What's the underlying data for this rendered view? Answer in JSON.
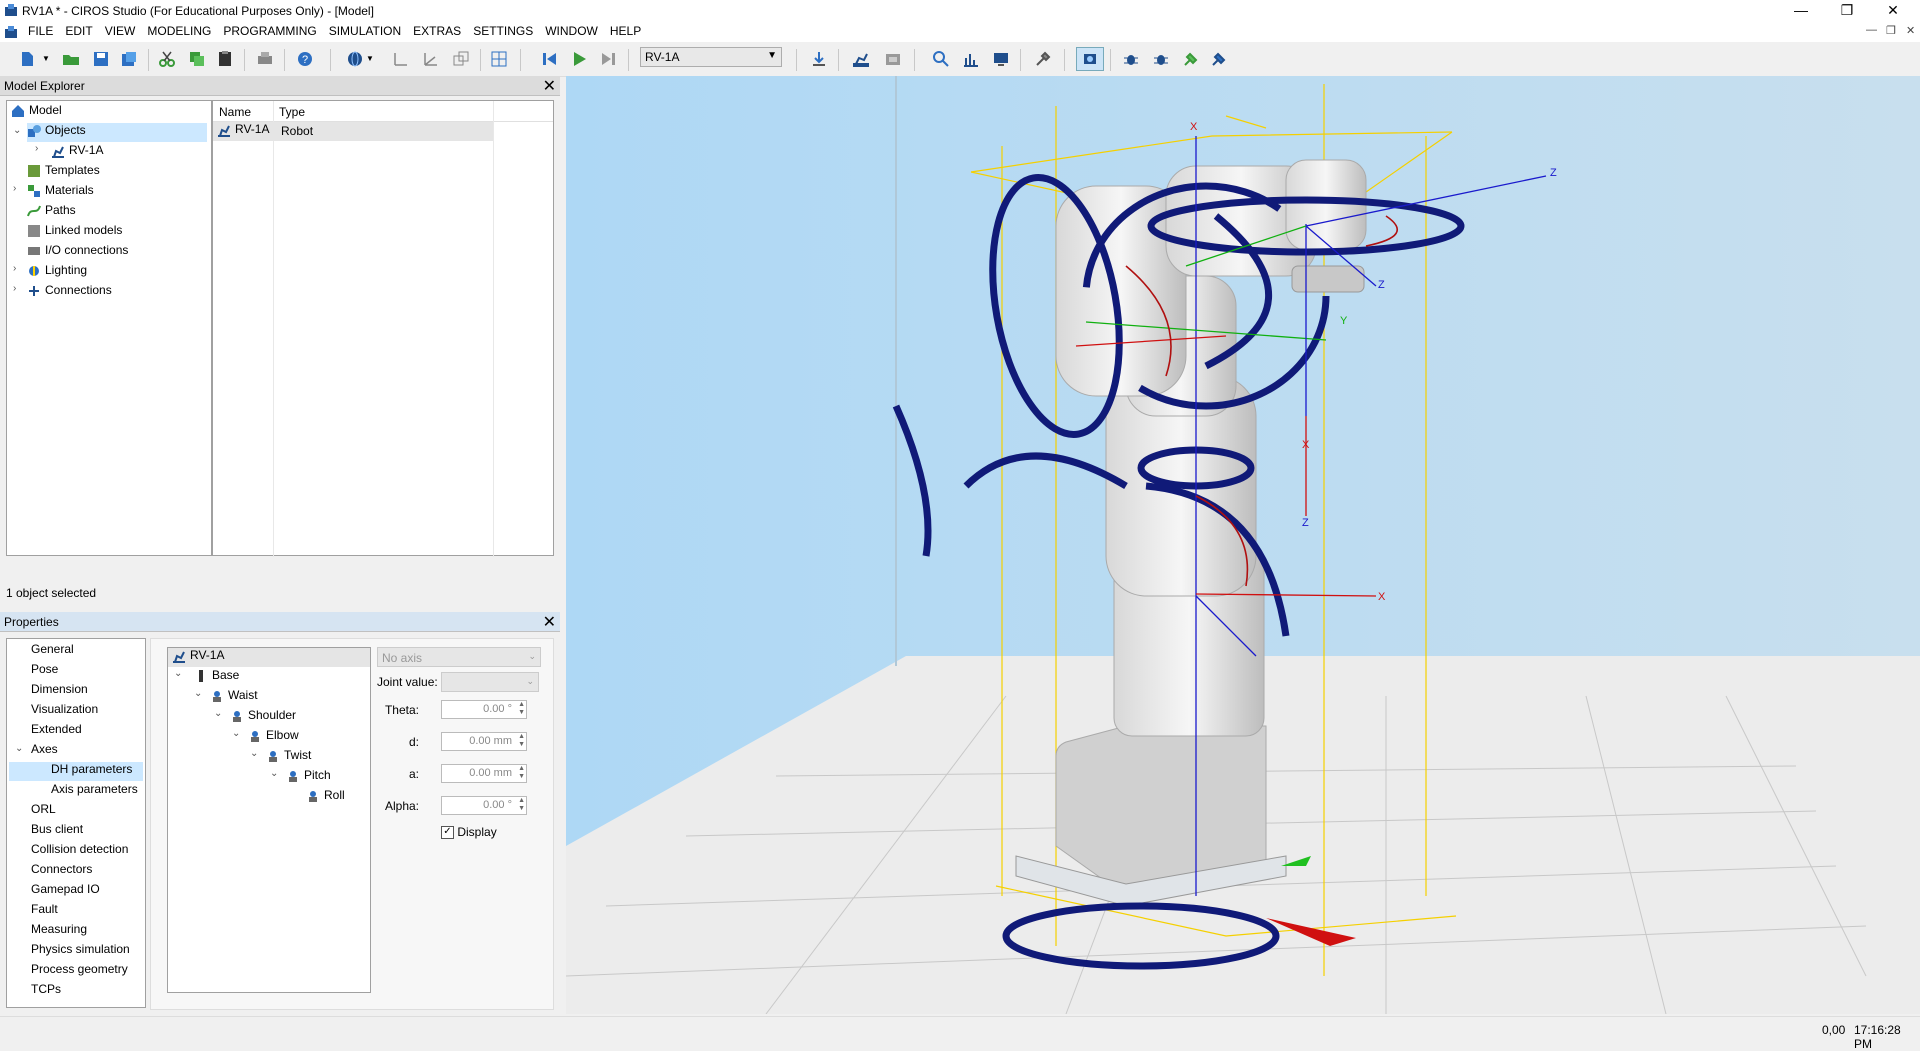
{
  "window": {
    "title": "RV1A * - CIROS Studio (For Educational Purposes Only) - [Model]",
    "minimize": "—",
    "restore": "❐",
    "close": "✕"
  },
  "menu": [
    "FILE",
    "EDIT",
    "VIEW",
    "MODELING",
    "PROGRAMMING",
    "SIMULATION",
    "EXTRAS",
    "SETTINGS",
    "WINDOW",
    "HELP"
  ],
  "toolbar": {
    "robot_select": "RV-1A"
  },
  "model_explorer": {
    "title": "Model Explorer",
    "tree": [
      {
        "label": "Model",
        "icon": "model-icon"
      },
      {
        "label": "Objects",
        "icon": "objects-icon"
      },
      {
        "label": "RV-1A",
        "icon": "robot-icon"
      },
      {
        "label": "Templates",
        "icon": "templates-icon"
      },
      {
        "label": "Materials",
        "icon": "materials-icon"
      },
      {
        "label": "Paths",
        "icon": "paths-icon"
      },
      {
        "label": "Linked models",
        "icon": "linked-models-icon"
      },
      {
        "label": "I/O connections",
        "icon": "io-connections-icon"
      },
      {
        "label": "Lighting",
        "icon": "lighting-icon"
      },
      {
        "label": "Connections",
        "icon": "connections-icon"
      }
    ],
    "columns": [
      "Name",
      "Type"
    ],
    "rows": [
      {
        "name": "RV-1A",
        "type": "Robot"
      }
    ],
    "status": "1 object selected"
  },
  "properties": {
    "title": "Properties",
    "categories": [
      "General",
      "Pose",
      "Dimension",
      "Visualization",
      "Extended",
      "Axes",
      "DH parameters",
      "Axis parameters",
      "ORL",
      "Bus client",
      "Collision detection",
      "Connectors",
      "Gamepad IO",
      "Fault",
      "Measuring",
      "Physics simulation",
      "Process geometry",
      "TCPs"
    ],
    "joint_tree": [
      "RV-1A",
      "Base",
      "Waist",
      "Shoulder",
      "Elbow",
      "Twist",
      "Pitch",
      "Roll"
    ],
    "axis_select": "No axis",
    "joint_value_label": "Joint value:",
    "theta_label": "Theta:",
    "theta_value": "0.00 °",
    "d_label": "d:",
    "d_value": "0.00 mm",
    "a_label": "a:",
    "a_value": "0.00 mm",
    "alpha_label": "Alpha:",
    "alpha_value": "0.00 °",
    "display_label": "Display",
    "display_checked": true
  },
  "viewport": {
    "axis_x": "X",
    "axis_y": "Y",
    "axis_z": "Z"
  },
  "status": {
    "coords": "0,00",
    "time": "17:16:28 PM"
  }
}
